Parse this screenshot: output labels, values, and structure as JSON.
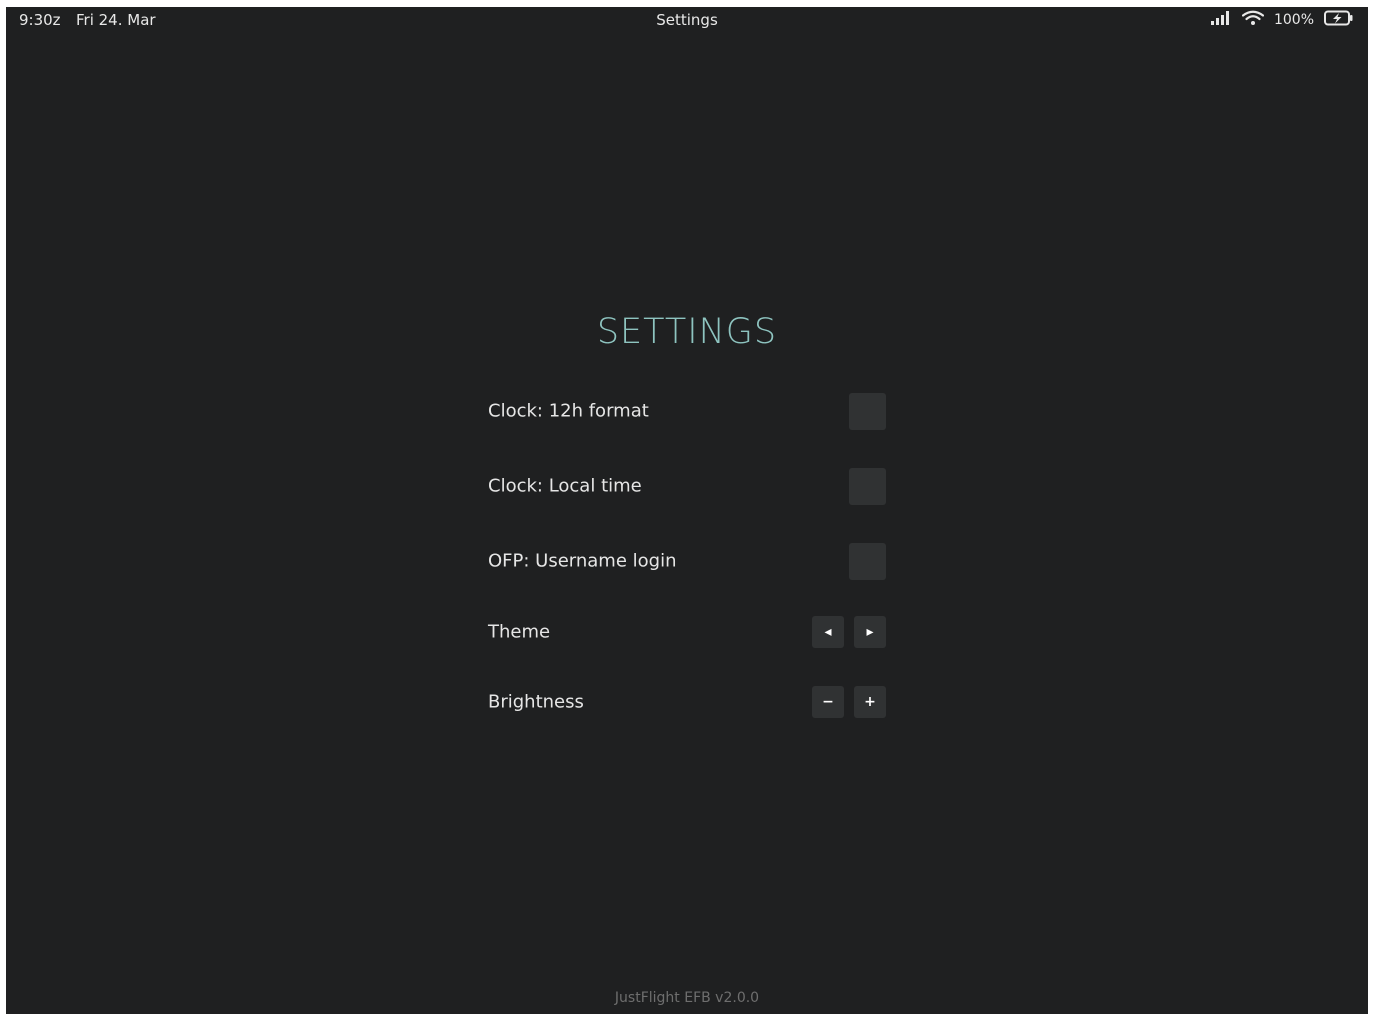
{
  "status_bar": {
    "time": "9:30z",
    "date": "Fri 24. Mar",
    "title": "Settings",
    "battery_percent": "100%",
    "icons": [
      "signal-icon",
      "wifi-icon",
      "battery-charging-icon"
    ]
  },
  "settings": {
    "heading": "SETTINGS",
    "rows": [
      {
        "label": "Clock: 12h format",
        "control": "checkbox",
        "checked": false
      },
      {
        "label": "Clock: Local time",
        "control": "checkbox",
        "checked": false
      },
      {
        "label": "OFP: Username login",
        "control": "checkbox",
        "checked": false
      },
      {
        "label": "Theme",
        "control": "arrows",
        "prev_symbol": "◂",
        "next_symbol": "▸"
      },
      {
        "label": "Brightness",
        "control": "stepper",
        "decrease_symbol": "−",
        "increase_symbol": "+"
      }
    ]
  },
  "footer": {
    "version_text": "JustFlight EFB v2.0.0"
  },
  "colors": {
    "background": "#1f2021",
    "heading_accent": "#8ec4c0",
    "control_bg": "#303233",
    "footer_text": "#6e6e6e"
  }
}
